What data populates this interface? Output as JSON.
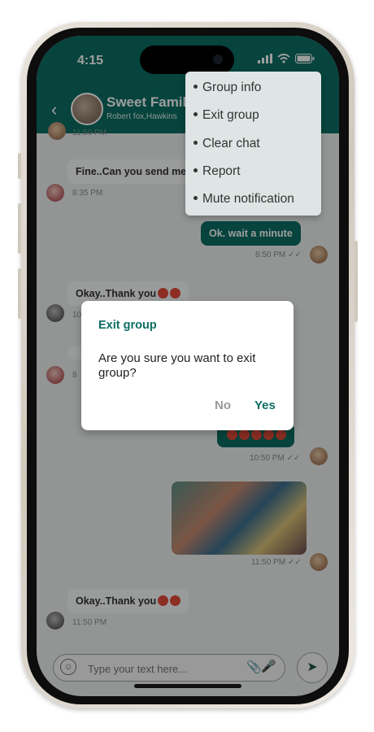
{
  "status_bar": {
    "time": "4:15"
  },
  "header": {
    "group_name": "Sweet Family",
    "members": "Robert fox,Hawkins"
  },
  "messages": [
    {
      "type": "in",
      "time": "11:50 PM"
    },
    {
      "type": "in",
      "text": "Fine..Can you send me",
      "time": "8:35 PM"
    },
    {
      "type": "out",
      "text": "Ok. wait a minute",
      "time": "8:50 PM"
    },
    {
      "type": "in",
      "text": "Okay..Thank you",
      "time": "10"
    },
    {
      "type": "in",
      "time": "8"
    },
    {
      "type": "out",
      "text": "",
      "time": "10:50 PM"
    },
    {
      "type": "out-photo",
      "time": "11:50 PM"
    },
    {
      "type": "in",
      "text": "Okay..Thank you",
      "time": "11:50 PM"
    }
  ],
  "composer": {
    "placeholder": "Type your text here..."
  },
  "menu": {
    "items": [
      "Group info",
      "Exit group",
      "Clear chat",
      "Report",
      "Mute notification"
    ]
  },
  "dialog": {
    "title": "Exit group",
    "message": "Are you sure you want to exit group?",
    "no_label": "No",
    "yes_label": "Yes"
  },
  "colors": {
    "brand": "#0b6e63",
    "menu_bg": "#dfe5e4"
  },
  "icons": [
    "back-arrow-icon",
    "signal-icon",
    "wifi-icon",
    "battery-icon",
    "smile-icon",
    "attach-icon",
    "mic-icon",
    "send-icon",
    "double-check-icon"
  ]
}
